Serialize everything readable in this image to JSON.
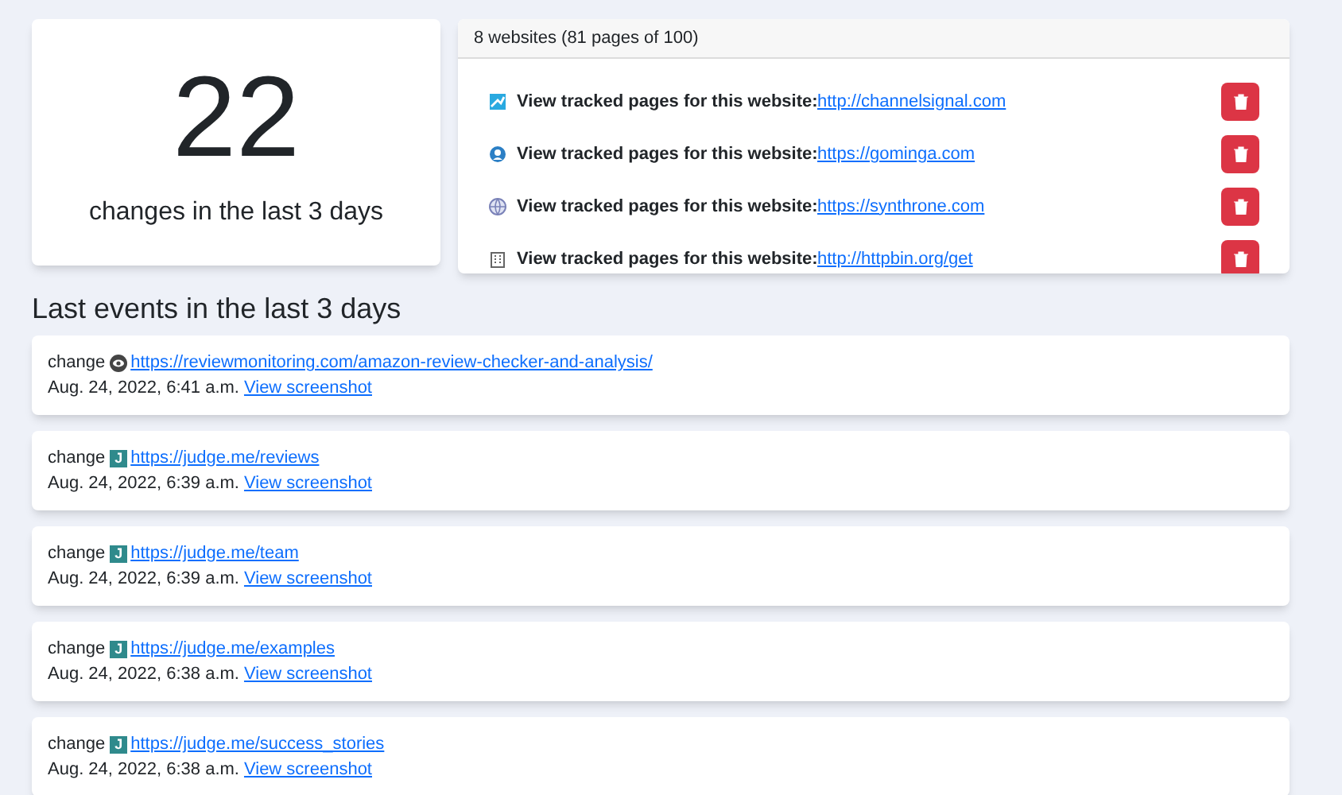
{
  "summary": {
    "count": "22",
    "caption": "changes in the last 3 days"
  },
  "websites": {
    "header": "8 websites (81 pages of 100)",
    "items": [
      {
        "kind": "chart",
        "label": "View tracked pages for this website:",
        "url": "http://channelsignal.com"
      },
      {
        "kind": "person",
        "label": "View tracked pages for this website:",
        "url": "https://gominga.com"
      },
      {
        "kind": "globe",
        "label": "View tracked pages for this website:",
        "url": "https://synthrone.com"
      },
      {
        "kind": "building",
        "label": "View tracked pages for this website:",
        "url": "http://httpbin.org/get"
      }
    ]
  },
  "events_title": "Last events in the last 3 days",
  "events": [
    {
      "type": "change",
      "favicon": {
        "kind": "eye"
      },
      "url": "https://reviewmonitoring.com/amazon-review-checker-and-analysis/",
      "time": "Aug. 24, 2022, 6:41 a.m.",
      "link": "View screenshot"
    },
    {
      "type": "change",
      "favicon": {
        "kind": "letter",
        "text": "J"
      },
      "url": "https://judge.me/reviews",
      "time": "Aug. 24, 2022, 6:39 a.m.",
      "link": "View screenshot"
    },
    {
      "type": "change",
      "favicon": {
        "kind": "letter",
        "text": "J"
      },
      "url": "https://judge.me/team",
      "time": "Aug. 24, 2022, 6:39 a.m.",
      "link": "View screenshot"
    },
    {
      "type": "change",
      "favicon": {
        "kind": "letter",
        "text": "J"
      },
      "url": "https://judge.me/examples",
      "time": "Aug. 24, 2022, 6:38 a.m.",
      "link": "View screenshot"
    },
    {
      "type": "change",
      "favicon": {
        "kind": "letter",
        "text": "J"
      },
      "url": "https://judge.me/success_stories",
      "time": "Aug. 24, 2022, 6:38 a.m.",
      "link": "View screenshot"
    }
  ]
}
